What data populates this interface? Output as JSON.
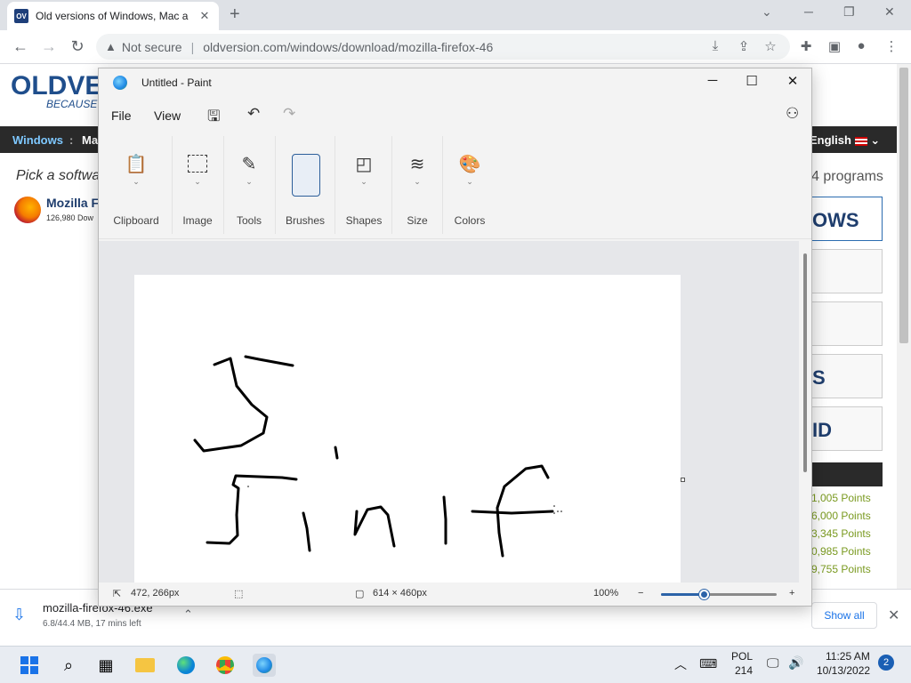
{
  "browser": {
    "tab_title": "Old versions of Windows, Mac a",
    "favicon_text": "OV",
    "url": "oldversion.com/windows/download/mozilla-firefox-46",
    "security_label": "Not secure"
  },
  "site": {
    "logo": "OLDVE",
    "slogan": "BECAUSE N",
    "nav": {
      "windows": "Windows",
      "separator": ":",
      "mac": "Ma",
      "language": "English"
    },
    "pick_text": "Pick a softwa",
    "programs_text": "4 programs",
    "item": {
      "name": "Mozilla F",
      "downloads": "126,980 Dow"
    },
    "sidebar": [
      "OWS",
      "",
      "",
      "S",
      "ID"
    ],
    "points": [
      "1,005 Points",
      "6,000 Points",
      "3,345 Points",
      "0,985 Points",
      "9,755 Points"
    ]
  },
  "download": {
    "filename": "mozilla-firefox-46.exe",
    "status": "6.8/44.4 MB, 17 mins left",
    "show_all": "Show all"
  },
  "paint": {
    "title": "Untitled - Paint",
    "menu": {
      "file": "File",
      "view": "View"
    },
    "groups": [
      {
        "label": "Clipboard",
        "icon": "clipboard-icon"
      },
      {
        "label": "Image",
        "icon": "select-icon"
      },
      {
        "label": "Tools",
        "icon": "tools-icon"
      },
      {
        "label": "Brushes",
        "icon": "brush-icon"
      },
      {
        "label": "Shapes",
        "icon": "shapes-icon"
      },
      {
        "label": "Size",
        "icon": "size-icon"
      },
      {
        "label": "Colors",
        "icon": "palette-icon"
      }
    ],
    "status": {
      "cursor": "472, 266px",
      "canvas_size": "614 × 460px",
      "zoom": "100%",
      "zoom_fraction": 0.38
    }
  },
  "taskbar": {
    "lang": "POL",
    "lang_sub": "214",
    "time": "11:25 AM",
    "date": "10/13/2022",
    "notifications": "2"
  }
}
